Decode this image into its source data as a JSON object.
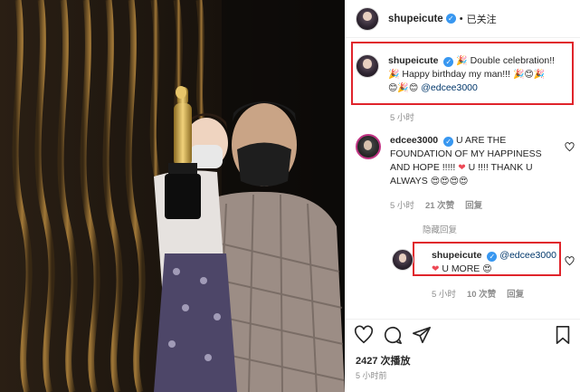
{
  "header": {
    "username": "shupeicute",
    "separator": "•",
    "follow_state": "已关注"
  },
  "caption": {
    "username": "shupeicute",
    "text_line1": "Double celebration!!",
    "text_line2": "Happy birthday my man!!!",
    "mention": "@edcee3000",
    "time": "5 小时"
  },
  "comments": [
    {
      "username": "edcee3000",
      "text_line1": "U ARE THE",
      "text_line2": "FOUNDATION OF MY HAPPINESS",
      "text_line3": "AND HOPE !!!!!",
      "text_line3b": "U !!!! THANK U",
      "text_line4": "ALWAYS",
      "time": "5 小时",
      "likes": "21 次赞",
      "reply": "回复",
      "view_replies": "隐藏回复"
    }
  ],
  "reply": {
    "username": "shupeicute",
    "mention": "@edcee3000",
    "text": "U MORE",
    "time": "5 小时",
    "likes": "10 次赞",
    "reply": "回复"
  },
  "post": {
    "views": "2427 次播放",
    "time": "5 小时前"
  },
  "colors": {
    "highlight_box": "#e0242b",
    "verified": "#3897f0",
    "mention": "#00376b",
    "heart": "#ed4956"
  },
  "icons": [
    "like-icon",
    "comment-icon",
    "share-icon",
    "bookmark-icon",
    "verified-icon",
    "heart-icon"
  ]
}
